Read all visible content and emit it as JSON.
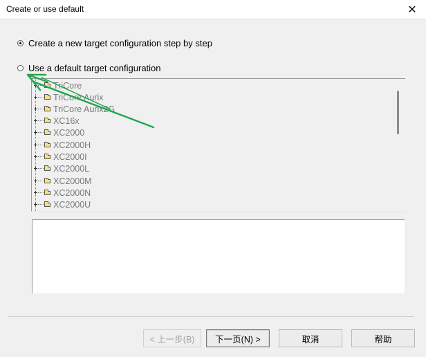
{
  "window": {
    "title": "Create or use default",
    "close_glyph": "✕"
  },
  "options": {
    "new_config_label": "Create a new target configuration step by step",
    "new_config_selected": true,
    "default_config_label": "Use a default target configuration",
    "default_config_selected": false
  },
  "tree": {
    "items": [
      {
        "label": "TriCore"
      },
      {
        "label": "TriCore Aurix"
      },
      {
        "label": "TriCore Aurix2G"
      },
      {
        "label": "XC16x"
      },
      {
        "label": "XC2000"
      },
      {
        "label": "XC2000H"
      },
      {
        "label": "XC2000I"
      },
      {
        "label": "XC2000L"
      },
      {
        "label": "XC2000M"
      },
      {
        "label": "XC2000N"
      },
      {
        "label": "XC2000U"
      }
    ]
  },
  "buttons": {
    "back": "< 上一步(B)",
    "next": "下一页(N) >",
    "cancel": "取消",
    "help": "帮助"
  },
  "annotation": {
    "arrow_color": "#22a650"
  }
}
